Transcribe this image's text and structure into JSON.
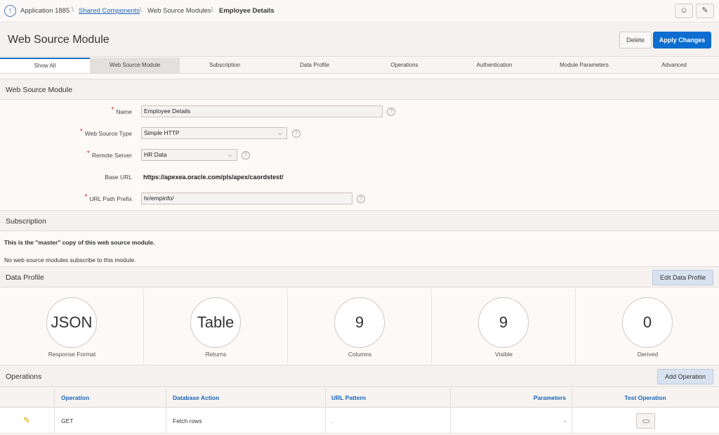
{
  "breadcrumb": {
    "app": "Application 1885",
    "shared": "Shared Components",
    "modules": "Web Source Modules",
    "current": "Employee Details"
  },
  "header": {
    "title": "Web Source Module",
    "delete_label": "Delete",
    "apply_label": "Apply Changes"
  },
  "tabs": [
    "Show All",
    "Web Source Module",
    "Subscription",
    "Data Profile",
    "Operations",
    "Authentication",
    "Module Parameters",
    "Advanced"
  ],
  "module_section": {
    "title": "Web Source Module",
    "name_label": "Name",
    "name_value": "Employee Details",
    "type_label": "Web Source Type",
    "type_value": "Simple HTTP",
    "server_label": "Remote Server",
    "server_value": "HR Data",
    "base_url_label": "Base URL",
    "base_url_value": "https://apexea.oracle.com/pls/apex/caordstest/",
    "prefix_label": "URL Path Prefix",
    "prefix_value": "hr/empinfo/"
  },
  "subscription": {
    "title": "Subscription",
    "master_text": "This is the \"master\" copy of this web source module.",
    "no_subs_text": "No web source modules subscribe to this module."
  },
  "data_profile": {
    "title": "Data Profile",
    "edit_label": "Edit Data Profile",
    "stats": [
      {
        "value": "JSON",
        "label": "Response Format"
      },
      {
        "value": "Table",
        "label": "Returns"
      },
      {
        "value": "9",
        "label": "Columns"
      },
      {
        "value": "9",
        "label": "Visible"
      },
      {
        "value": "0",
        "label": "Derived"
      }
    ]
  },
  "operations": {
    "title": "Operations",
    "add_label": "Add Operation",
    "headers": {
      "operation": "Operation",
      "db_action": "Database Action",
      "url_pattern": "URL Pattern",
      "parameters": "Parameters",
      "test": "Test Operation"
    },
    "rows": [
      {
        "operation": "GET",
        "db_action": "Fetch rows",
        "url_pattern": ".",
        "parameters": "-"
      }
    ]
  },
  "icons": {
    "up": "arrow-up-circle-icon",
    "help": "help-icon",
    "edit": "pencil-icon",
    "feedback": "chat-plus-icon",
    "tools": "wrench-icon"
  }
}
